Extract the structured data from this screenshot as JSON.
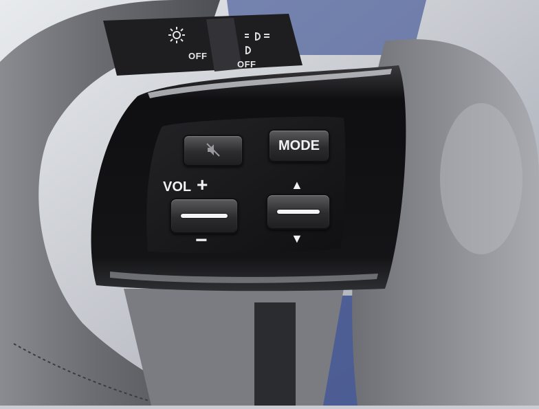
{
  "stalk": {
    "off_left": "OFF",
    "off_right": "OFF"
  },
  "controls": {
    "mode_label": "MODE",
    "vol_label": "VOL",
    "vol_plus": "+",
    "vol_minus": "−",
    "seek_up": "▲",
    "seek_down": "▼"
  },
  "icons": {
    "mute": "mute-speaker-icon",
    "headlight": "headlight-sun-icon",
    "fog": "fog-light-icon"
  },
  "colors": {
    "panel": "#151517",
    "bezel": "#0d0d0f",
    "leather": "#6e6e72",
    "label": "#f2f2f2"
  }
}
